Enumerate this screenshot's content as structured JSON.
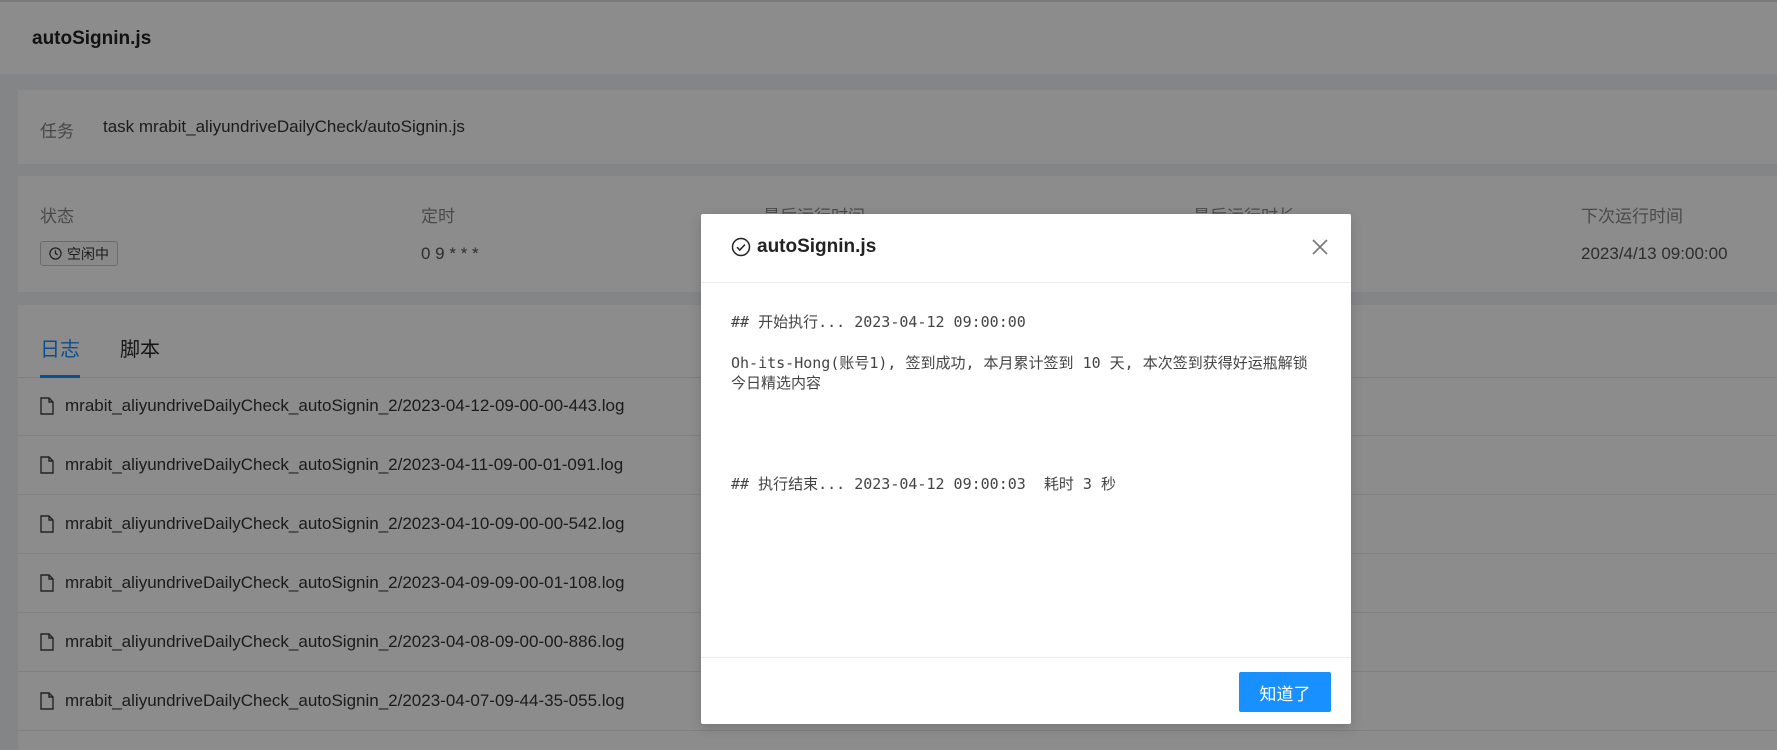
{
  "header": {
    "title": "autoSignin.js"
  },
  "task": {
    "label": "任务",
    "value_visible_prefix": "task mrabit_aliyundriveDailyCheck/autoSignin.js"
  },
  "status": {
    "columns": [
      {
        "label": "状态",
        "value": "空闲中"
      },
      {
        "label": "定时",
        "value": "0 9 * * *"
      },
      {
        "label": "最后运行时间",
        "value": ""
      },
      {
        "label": "最后运行时长",
        "value": ""
      },
      {
        "label": "下次运行时间",
        "value": "2023/4/13 09:00:00"
      }
    ]
  },
  "tabs": [
    {
      "label": "日志",
      "active": true
    },
    {
      "label": "脚本",
      "active": false
    }
  ],
  "logs": [
    "mrabit_aliyundriveDailyCheck_autoSignin_2/2023-04-12-09-00-00-443.log",
    "mrabit_aliyundriveDailyCheck_autoSignin_2/2023-04-11-09-00-01-091.log",
    "mrabit_aliyundriveDailyCheck_autoSignin_2/2023-04-10-09-00-00-542.log",
    "mrabit_aliyundriveDailyCheck_autoSignin_2/2023-04-09-09-00-01-108.log",
    "mrabit_aliyundriveDailyCheck_autoSignin_2/2023-04-08-09-00-00-886.log",
    "mrabit_aliyundriveDailyCheck_autoSignin_2/2023-04-07-09-44-35-055.log"
  ],
  "modal": {
    "title": "autoSignin.js",
    "lines": [
      "## 开始执行... 2023-04-12 09:00:00",
      "Oh-its-Hong(账号1), 签到成功, 本月累计签到 10 天, 本次签到获得好运瓶解锁今日精选内容",
      "## 执行结束... 2023-04-12 09:00:03  耗时 3 秒"
    ],
    "ok_label": "知道了"
  },
  "colors": {
    "primary": "#1890ff",
    "mask": "rgba(0,0,0,0.45)"
  }
}
